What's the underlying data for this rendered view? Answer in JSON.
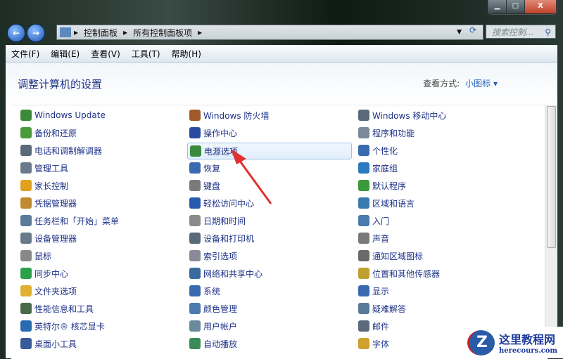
{
  "window": {
    "minimize": "▁",
    "maximize": "□",
    "close": "X"
  },
  "address": {
    "segments": [
      "控制面板",
      "所有控制面板项"
    ],
    "search_placeholder": "搜索控制..."
  },
  "menu": [
    "文件(F)",
    "编辑(E)",
    "查看(V)",
    "工具(T)",
    "帮助(H)"
  ],
  "header": {
    "title": "调整计算机的设置",
    "view_label": "查看方式:",
    "view_value": "小图标 ▾"
  },
  "columns": [
    [
      {
        "label": "Windows Update",
        "color": "#3a8a3a"
      },
      {
        "label": "备份和还原",
        "color": "#4a9a3a"
      },
      {
        "label": "电话和调制解调器",
        "color": "#5a6a7a"
      },
      {
        "label": "管理工具",
        "color": "#6a7a8a"
      },
      {
        "label": "家长控制",
        "color": "#e0a020"
      },
      {
        "label": "凭据管理器",
        "color": "#c08a30"
      },
      {
        "label": "任务栏和「开始」菜单",
        "color": "#5a7a9a"
      },
      {
        "label": "设备管理器",
        "color": "#6a7a8a"
      },
      {
        "label": "鼠标",
        "color": "#888888"
      },
      {
        "label": "同步中心",
        "color": "#2aa04a"
      },
      {
        "label": "文件夹选项",
        "color": "#e0b030"
      },
      {
        "label": "性能信息和工具",
        "color": "#4a6a4a"
      },
      {
        "label": "英特尔® 核芯显卡",
        "color": "#2a6ab0"
      },
      {
        "label": "桌面小工具",
        "color": "#3a5a9a"
      }
    ],
    [
      {
        "label": "Windows 防火墙",
        "color": "#a05a2a"
      },
      {
        "label": "操作中心",
        "color": "#2a4aa0"
      },
      {
        "label": "电源选项",
        "color": "#3a8a3a",
        "selected": true
      },
      {
        "label": "恢复",
        "color": "#3a6ab0"
      },
      {
        "label": "键盘",
        "color": "#7a7a7a"
      },
      {
        "label": "轻松访问中心",
        "color": "#2a5ab0"
      },
      {
        "label": "日期和时间",
        "color": "#8a8a8a"
      },
      {
        "label": "设备和打印机",
        "color": "#5a6a7a"
      },
      {
        "label": "索引选项",
        "color": "#8a8a9a"
      },
      {
        "label": "网络和共享中心",
        "color": "#3a6aa0"
      },
      {
        "label": "系统",
        "color": "#3a6ab0"
      },
      {
        "label": "颜色管理",
        "color": "#4a7ab0"
      },
      {
        "label": "用户帐户",
        "color": "#6a8a9a"
      },
      {
        "label": "自动播放",
        "color": "#3a8a5a"
      }
    ],
    [
      {
        "label": "Windows 移动中心",
        "color": "#5a6a7a"
      },
      {
        "label": "程序和功能",
        "color": "#7a8a9a"
      },
      {
        "label": "个性化",
        "color": "#3a6ab0"
      },
      {
        "label": "家庭组",
        "color": "#2a7ac0"
      },
      {
        "label": "默认程序",
        "color": "#3a9a3a"
      },
      {
        "label": "区域和语言",
        "color": "#3a7ab0"
      },
      {
        "label": "入门",
        "color": "#4a7ab0"
      },
      {
        "label": "声音",
        "color": "#7a7a7a"
      },
      {
        "label": "通知区域图标",
        "color": "#6a6a6a"
      },
      {
        "label": "位置和其他传感器",
        "color": "#c0a030"
      },
      {
        "label": "显示",
        "color": "#3a6ab0"
      },
      {
        "label": "疑难解答",
        "color": "#5a7a9a"
      },
      {
        "label": "邮件",
        "color": "#5a6a7a"
      },
      {
        "label": "字体",
        "color": "#d0a030"
      }
    ]
  ],
  "watermark": {
    "name": "这里教程网",
    "url": "herecours.com"
  },
  "colors": {
    "link": "#1e3287",
    "arrow": "#e03030"
  }
}
